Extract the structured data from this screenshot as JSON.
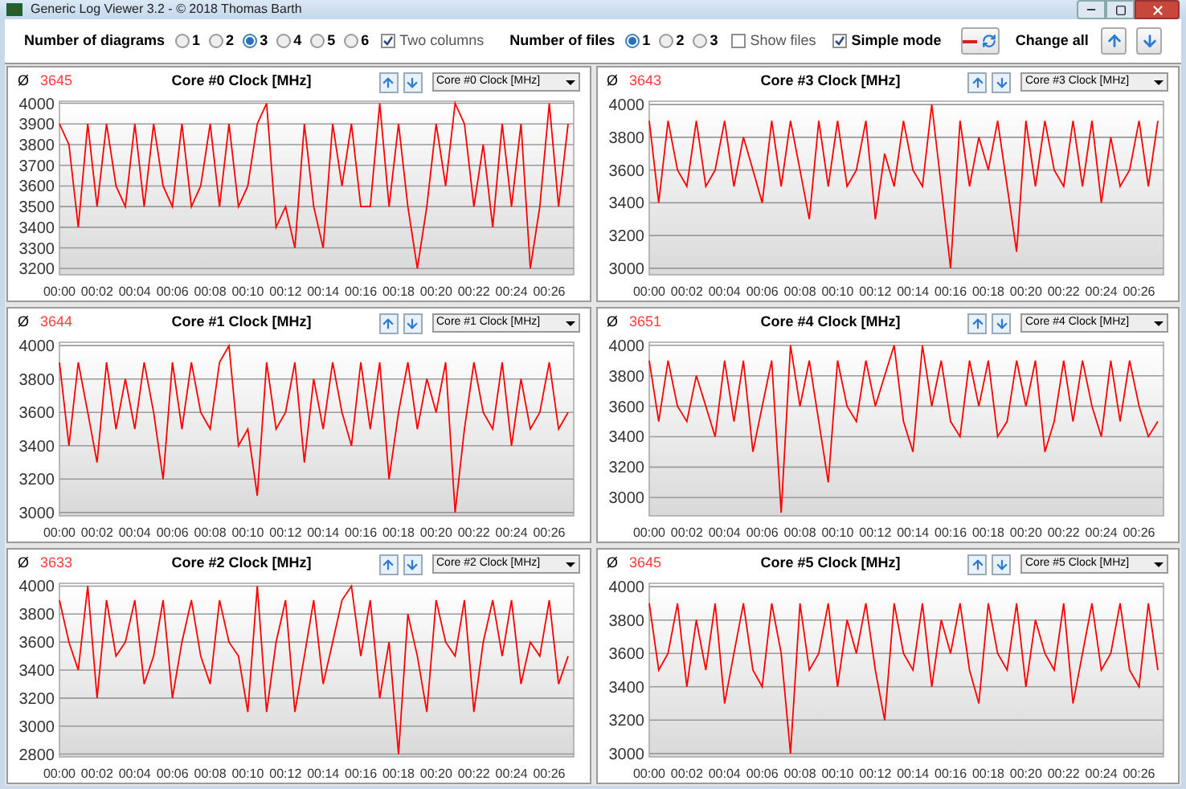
{
  "window": {
    "title": "Generic Log Viewer 3.2 - © 2018 Thomas Barth"
  },
  "toolbar": {
    "diagrams": {
      "label": "Number of diagrams",
      "options": [
        {
          "label": "1",
          "selected": false
        },
        {
          "label": "2",
          "selected": false
        },
        {
          "label": "3",
          "selected": true
        },
        {
          "label": "4",
          "selected": false
        },
        {
          "label": "5",
          "selected": false
        },
        {
          "label": "6",
          "selected": false
        }
      ]
    },
    "two_columns": {
      "label": "Two columns",
      "checked": true
    },
    "files": {
      "label": "Number of files",
      "options": [
        {
          "label": "1",
          "selected": true
        },
        {
          "label": "2",
          "selected": false
        },
        {
          "label": "3",
          "selected": false
        }
      ]
    },
    "show_files": {
      "label": "Show files",
      "checked": false
    },
    "simple_mode": {
      "label": "Simple mode",
      "checked": true
    },
    "change_all": {
      "label": "Change all"
    }
  },
  "charts": [
    {
      "avg_symbol": "Ø",
      "average": "3645",
      "chart_data": {
        "type": "line",
        "title": "Core #0 Clock [MHz]",
        "grid": true,
        "xlim": [
          0,
          27.3
        ],
        "x": [
          0,
          0.5,
          1,
          1.5,
          2,
          2.5,
          3,
          3.5,
          4,
          4.5,
          5,
          5.5,
          6,
          6.5,
          7,
          7.5,
          8,
          8.5,
          9,
          9.5,
          10,
          10.5,
          11,
          11.5,
          12,
          12.5,
          13,
          13.5,
          14,
          14.5,
          15,
          15.5,
          16,
          16.5,
          17,
          17.5,
          18,
          18.5,
          19,
          19.5,
          20,
          20.5,
          21,
          21.5,
          22,
          22.5,
          23,
          23.5,
          24,
          24.5,
          25,
          25.5,
          26,
          26.5,
          27
        ],
        "ylim": [
          3170,
          4010
        ],
        "yticks": [
          3200,
          3300,
          3400,
          3500,
          3600,
          3700,
          3800,
          3900,
          4000
        ],
        "xticks": [
          {
            "value": 0,
            "label": "00:00"
          },
          {
            "value": 2,
            "label": "00:02"
          },
          {
            "value": 4,
            "label": "00:04"
          },
          {
            "value": 6,
            "label": "00:06"
          },
          {
            "value": 8,
            "label": "00:08"
          },
          {
            "value": 10,
            "label": "00:10"
          },
          {
            "value": 12,
            "label": "00:12"
          },
          {
            "value": 14,
            "label": "00:14"
          },
          {
            "value": 16,
            "label": "00:16"
          },
          {
            "value": 18,
            "label": "00:18"
          },
          {
            "value": 20,
            "label": "00:20"
          },
          {
            "value": 22,
            "label": "00:22"
          },
          {
            "value": 24,
            "label": "00:24"
          },
          {
            "value": 26,
            "label": "00:26"
          }
        ],
        "series": [
          {
            "name": "Core #0 Clock [MHz]",
            "color": "#ff0000",
            "values": [
              3900,
              3800,
              3400,
              3900,
              3500,
              3900,
              3600,
              3500,
              3900,
              3500,
              3900,
              3600,
              3500,
              3900,
              3500,
              3600,
              3900,
              3500,
              3900,
              3500,
              3600,
              3900,
              4000,
              3400,
              3500,
              3300,
              3900,
              3500,
              3300,
              3900,
              3600,
              3900,
              3500,
              3500,
              4000,
              3500,
              3900,
              3500,
              3200,
              3500,
              3900,
              3600,
              4000,
              3900,
              3500,
              3800,
              3400,
              3900,
              3500,
              3900,
              3200,
              3500,
              4000,
              3500,
              3900
            ]
          }
        ]
      }
    },
    {
      "avg_symbol": "Ø",
      "average": "3643",
      "chart_data": {
        "type": "line",
        "title": "Core #3 Clock [MHz]",
        "grid": true,
        "xlim": [
          0,
          27.3
        ],
        "x": [
          0,
          0.5,
          1,
          1.5,
          2,
          2.5,
          3,
          3.5,
          4,
          4.5,
          5,
          5.5,
          6,
          6.5,
          7,
          7.5,
          8,
          8.5,
          9,
          9.5,
          10,
          10.5,
          11,
          11.5,
          12,
          12.5,
          13,
          13.5,
          14,
          14.5,
          15,
          15.5,
          16,
          16.5,
          17,
          17.5,
          18,
          18.5,
          19,
          19.5,
          20,
          20.5,
          21,
          21.5,
          22,
          22.5,
          23,
          23.5,
          24,
          24.5,
          25,
          25.5,
          26,
          26.5,
          27
        ],
        "ylim": [
          2960,
          4020
        ],
        "yticks": [
          3000,
          3200,
          3400,
          3600,
          3800,
          4000
        ],
        "xticks": [
          {
            "value": 0,
            "label": "00:00"
          },
          {
            "value": 2,
            "label": "00:02"
          },
          {
            "value": 4,
            "label": "00:04"
          },
          {
            "value": 6,
            "label": "00:06"
          },
          {
            "value": 8,
            "label": "00:08"
          },
          {
            "value": 10,
            "label": "00:10"
          },
          {
            "value": 12,
            "label": "00:12"
          },
          {
            "value": 14,
            "label": "00:14"
          },
          {
            "value": 16,
            "label": "00:16"
          },
          {
            "value": 18,
            "label": "00:18"
          },
          {
            "value": 20,
            "label": "00:20"
          },
          {
            "value": 22,
            "label": "00:22"
          },
          {
            "value": 24,
            "label": "00:24"
          },
          {
            "value": 26,
            "label": "00:26"
          }
        ],
        "series": [
          {
            "name": "Core #3 Clock [MHz]",
            "color": "#ff0000",
            "values": [
              3900,
              3400,
              3900,
              3600,
              3500,
              3900,
              3500,
              3600,
              3900,
              3500,
              3800,
              3600,
              3400,
              3900,
              3500,
              3900,
              3600,
              3300,
              3900,
              3500,
              3900,
              3500,
              3600,
              3900,
              3300,
              3700,
              3500,
              3900,
              3600,
              3500,
              4000,
              3500,
              3000,
              3900,
              3500,
              3800,
              3600,
              3900,
              3500,
              3100,
              3900,
              3500,
              3900,
              3600,
              3500,
              3900,
              3500,
              3900,
              3400,
              3800,
              3500,
              3600,
              3900,
              3500,
              3900
            ]
          }
        ]
      }
    },
    {
      "avg_symbol": "Ø",
      "average": "3644",
      "chart_data": {
        "type": "line",
        "title": "Core #1 Clock [MHz]",
        "grid": true,
        "xlim": [
          0,
          27.3
        ],
        "x": [
          0,
          0.5,
          1,
          1.5,
          2,
          2.5,
          3,
          3.5,
          4,
          4.5,
          5,
          5.5,
          6,
          6.5,
          7,
          7.5,
          8,
          8.5,
          9,
          9.5,
          10,
          10.5,
          11,
          11.5,
          12,
          12.5,
          13,
          13.5,
          14,
          14.5,
          15,
          15.5,
          16,
          16.5,
          17,
          17.5,
          18,
          18.5,
          19,
          19.5,
          20,
          20.5,
          21,
          21.5,
          22,
          22.5,
          23,
          23.5,
          24,
          24.5,
          25,
          25.5,
          26,
          26.5,
          27
        ],
        "ylim": [
          2980,
          4020
        ],
        "yticks": [
          3000,
          3200,
          3400,
          3600,
          3800,
          4000
        ],
        "xticks": [
          {
            "value": 0,
            "label": "00:00"
          },
          {
            "value": 2,
            "label": "00:02"
          },
          {
            "value": 4,
            "label": "00:04"
          },
          {
            "value": 6,
            "label": "00:06"
          },
          {
            "value": 8,
            "label": "00:08"
          },
          {
            "value": 10,
            "label": "00:10"
          },
          {
            "value": 12,
            "label": "00:12"
          },
          {
            "value": 14,
            "label": "00:14"
          },
          {
            "value": 16,
            "label": "00:16"
          },
          {
            "value": 18,
            "label": "00:18"
          },
          {
            "value": 20,
            "label": "00:20"
          },
          {
            "value": 22,
            "label": "00:22"
          },
          {
            "value": 24,
            "label": "00:24"
          },
          {
            "value": 26,
            "label": "00:26"
          }
        ],
        "series": [
          {
            "name": "Core #1 Clock [MHz]",
            "color": "#ff0000",
            "values": [
              3900,
              3400,
              3900,
              3600,
              3300,
              3900,
              3500,
              3800,
              3500,
              3900,
              3600,
              3200,
              3900,
              3500,
              3900,
              3600,
              3500,
              3900,
              4000,
              3400,
              3500,
              3100,
              3900,
              3500,
              3600,
              3900,
              3300,
              3800,
              3500,
              3900,
              3600,
              3400,
              3900,
              3500,
              3900,
              3200,
              3600,
              3900,
              3500,
              3800,
              3600,
              3900,
              3000,
              3500,
              3900,
              3600,
              3500,
              3900,
              3400,
              3800,
              3500,
              3600,
              3900,
              3500,
              3600
            ]
          }
        ]
      }
    },
    {
      "avg_symbol": "Ø",
      "average": "3651",
      "chart_data": {
        "type": "line",
        "title": "Core #4 Clock [MHz]",
        "grid": true,
        "xlim": [
          0,
          27.3
        ],
        "x": [
          0,
          0.5,
          1,
          1.5,
          2,
          2.5,
          3,
          3.5,
          4,
          4.5,
          5,
          5.5,
          6,
          6.5,
          7,
          7.5,
          8,
          8.5,
          9,
          9.5,
          10,
          10.5,
          11,
          11.5,
          12,
          12.5,
          13,
          13.5,
          14,
          14.5,
          15,
          15.5,
          16,
          16.5,
          17,
          17.5,
          18,
          18.5,
          19,
          19.5,
          20,
          20.5,
          21,
          21.5,
          22,
          22.5,
          23,
          23.5,
          24,
          24.5,
          25,
          25.5,
          26,
          26.5,
          27
        ],
        "ylim": [
          2880,
          4020
        ],
        "yticks": [
          3000,
          3200,
          3400,
          3600,
          3800,
          4000
        ],
        "xticks": [
          {
            "value": 0,
            "label": "00:00"
          },
          {
            "value": 2,
            "label": "00:02"
          },
          {
            "value": 4,
            "label": "00:04"
          },
          {
            "value": 6,
            "label": "00:06"
          },
          {
            "value": 8,
            "label": "00:08"
          },
          {
            "value": 10,
            "label": "00:10"
          },
          {
            "value": 12,
            "label": "00:12"
          },
          {
            "value": 14,
            "label": "00:14"
          },
          {
            "value": 16,
            "label": "00:16"
          },
          {
            "value": 18,
            "label": "00:18"
          },
          {
            "value": 20,
            "label": "00:20"
          },
          {
            "value": 22,
            "label": "00:22"
          },
          {
            "value": 24,
            "label": "00:24"
          },
          {
            "value": 26,
            "label": "00:26"
          }
        ],
        "series": [
          {
            "name": "Core #4 Clock [MHz]",
            "color": "#ff0000",
            "values": [
              3900,
              3500,
              3900,
              3600,
              3500,
              3800,
              3600,
              3400,
              3900,
              3500,
              3900,
              3300,
              3600,
              3900,
              2900,
              4000,
              3600,
              3900,
              3500,
              3100,
              3900,
              3600,
              3500,
              3900,
              3600,
              3800,
              4000,
              3500,
              3300,
              4000,
              3600,
              3900,
              3500,
              3400,
              3900,
              3600,
              3900,
              3400,
              3500,
              3900,
              3600,
              3900,
              3300,
              3500,
              3900,
              3500,
              3900,
              3600,
              3400,
              3900,
              3500,
              3900,
              3600,
              3400,
              3500
            ]
          }
        ]
      }
    },
    {
      "avg_symbol": "Ø",
      "average": "3633",
      "chart_data": {
        "type": "line",
        "title": "Core #2 Clock [MHz]",
        "grid": true,
        "xlim": [
          0,
          27.3
        ],
        "x": [
          0,
          0.5,
          1,
          1.5,
          2,
          2.5,
          3,
          3.5,
          4,
          4.5,
          5,
          5.5,
          6,
          6.5,
          7,
          7.5,
          8,
          8.5,
          9,
          9.5,
          10,
          10.5,
          11,
          11.5,
          12,
          12.5,
          13,
          13.5,
          14,
          14.5,
          15,
          15.5,
          16,
          16.5,
          17,
          17.5,
          18,
          18.5,
          19,
          19.5,
          20,
          20.5,
          21,
          21.5,
          22,
          22.5,
          23,
          23.5,
          24,
          24.5,
          25,
          25.5,
          26,
          26.5,
          27
        ],
        "ylim": [
          2780,
          4020
        ],
        "yticks": [
          2800,
          3000,
          3200,
          3400,
          3600,
          3800,
          4000
        ],
        "xticks": [
          {
            "value": 0,
            "label": "00:00"
          },
          {
            "value": 2,
            "label": "00:02"
          },
          {
            "value": 4,
            "label": "00:04"
          },
          {
            "value": 6,
            "label": "00:06"
          },
          {
            "value": 8,
            "label": "00:08"
          },
          {
            "value": 10,
            "label": "00:10"
          },
          {
            "value": 12,
            "label": "00:12"
          },
          {
            "value": 14,
            "label": "00:14"
          },
          {
            "value": 16,
            "label": "00:16"
          },
          {
            "value": 18,
            "label": "00:18"
          },
          {
            "value": 20,
            "label": "00:20"
          },
          {
            "value": 22,
            "label": "00:22"
          },
          {
            "value": 24,
            "label": "00:24"
          },
          {
            "value": 26,
            "label": "00:26"
          }
        ],
        "series": [
          {
            "name": "Core #2 Clock [MHz]",
            "color": "#ff0000",
            "values": [
              3900,
              3600,
              3400,
              4000,
              3200,
              3900,
              3500,
              3600,
              3900,
              3300,
              3500,
              3900,
              3200,
              3600,
              3900,
              3500,
              3300,
              3900,
              3600,
              3500,
              3100,
              4000,
              3100,
              3600,
              3900,
              3100,
              3500,
              3900,
              3300,
              3600,
              3900,
              4000,
              3500,
              3900,
              3200,
              3600,
              2800,
              3800,
              3500,
              3100,
              3900,
              3600,
              3500,
              3900,
              3100,
              3600,
              3900,
              3500,
              3900,
              3300,
              3600,
              3500,
              3900,
              3300,
              3500
            ]
          }
        ]
      }
    },
    {
      "avg_symbol": "Ø",
      "average": "3645",
      "chart_data": {
        "type": "line",
        "title": "Core #5 Clock [MHz]",
        "grid": true,
        "xlim": [
          0,
          27.3
        ],
        "x": [
          0,
          0.5,
          1,
          1.5,
          2,
          2.5,
          3,
          3.5,
          4,
          4.5,
          5,
          5.5,
          6,
          6.5,
          7,
          7.5,
          8,
          8.5,
          9,
          9.5,
          10,
          10.5,
          11,
          11.5,
          12,
          12.5,
          13,
          13.5,
          14,
          14.5,
          15,
          15.5,
          16,
          16.5,
          17,
          17.5,
          18,
          18.5,
          19,
          19.5,
          20,
          20.5,
          21,
          21.5,
          22,
          22.5,
          23,
          23.5,
          24,
          24.5,
          25,
          25.5,
          26,
          26.5,
          27
        ],
        "ylim": [
          2980,
          4020
        ],
        "yticks": [
          3000,
          3200,
          3400,
          3600,
          3800,
          4000
        ],
        "xticks": [
          {
            "value": 0,
            "label": "00:00"
          },
          {
            "value": 2,
            "label": "00:02"
          },
          {
            "value": 4,
            "label": "00:04"
          },
          {
            "value": 6,
            "label": "00:06"
          },
          {
            "value": 8,
            "label": "00:08"
          },
          {
            "value": 10,
            "label": "00:10"
          },
          {
            "value": 12,
            "label": "00:12"
          },
          {
            "value": 14,
            "label": "00:14"
          },
          {
            "value": 16,
            "label": "00:16"
          },
          {
            "value": 18,
            "label": "00:18"
          },
          {
            "value": 20,
            "label": "00:20"
          },
          {
            "value": 22,
            "label": "00:22"
          },
          {
            "value": 24,
            "label": "00:24"
          },
          {
            "value": 26,
            "label": "00:26"
          }
        ],
        "series": [
          {
            "name": "Core #5 Clock [MHz]",
            "color": "#ff0000",
            "values": [
              3900,
              3500,
              3600,
              3900,
              3400,
              3800,
              3500,
              3900,
              3300,
              3600,
              3900,
              3500,
              3400,
              3900,
              3600,
              3000,
              3900,
              3500,
              3600,
              3900,
              3400,
              3800,
              3600,
              3900,
              3500,
              3200,
              3900,
              3600,
              3500,
              3900,
              3400,
              3800,
              3600,
              3900,
              3500,
              3300,
              3900,
              3600,
              3500,
              3900,
              3400,
              3800,
              3600,
              3500,
              3900,
              3300,
              3600,
              3900,
              3500,
              3600,
              3900,
              3500,
              3400,
              3900,
              3500
            ]
          }
        ]
      }
    }
  ]
}
